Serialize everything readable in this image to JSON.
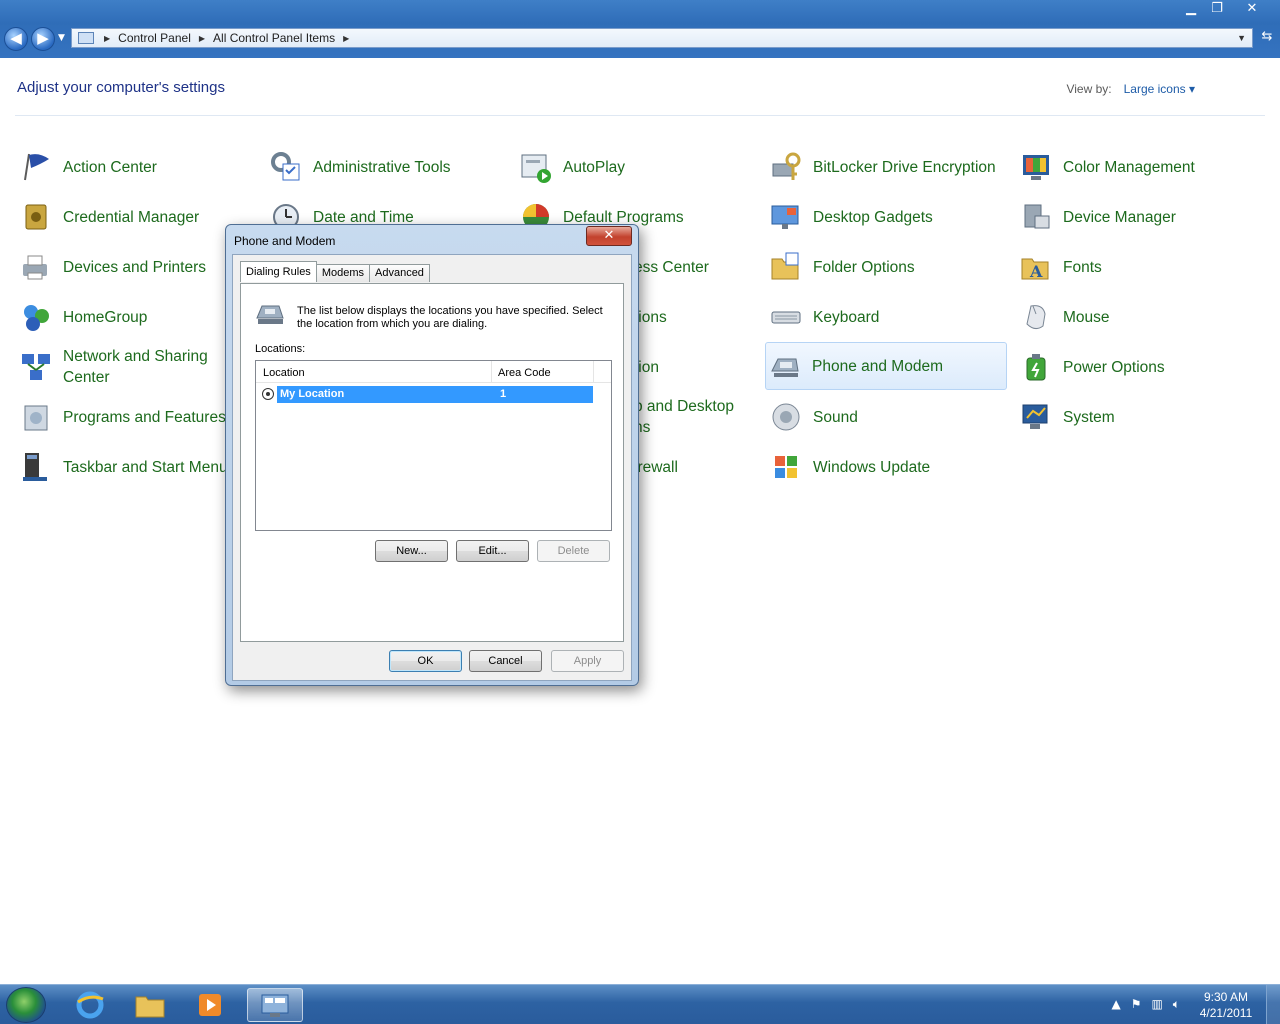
{
  "window": {
    "minimize": "▁",
    "restore": "❐",
    "close": "✕"
  },
  "address_bar": {
    "crumbs": [
      "Control Panel",
      "All Control Panel Items"
    ]
  },
  "heading": "Adjust your computer's settings",
  "view_by": {
    "label": "View by:",
    "value": "Large icons ▾"
  },
  "items": [
    {
      "label": "Action Center",
      "icon": "flag-icon"
    },
    {
      "label": "Administrative Tools",
      "icon": "admin-tools-icon"
    },
    {
      "label": "AutoPlay",
      "icon": "autoplay-icon"
    },
    {
      "label": "BitLocker Drive Encryption",
      "icon": "bitlocker-icon"
    },
    {
      "label": "Color Management",
      "icon": "color-management-icon"
    },
    {
      "label": "Credential Manager",
      "icon": "vault-icon"
    },
    {
      "label": "Date and Time",
      "icon": "clock-icon"
    },
    {
      "label": "Default Programs",
      "icon": "default-programs-icon"
    },
    {
      "label": "Desktop Gadgets",
      "icon": "gadgets-icon"
    },
    {
      "label": "Device Manager",
      "icon": "device-manager-icon"
    },
    {
      "label": "Devices and Printers",
      "icon": "printer-icon"
    },
    {
      "label": "ess Center",
      "icon": ""
    },
    {
      "label": "Folder Options",
      "icon": "folder-icon"
    },
    {
      "label": "Fonts",
      "icon": "fonts-icon"
    },
    {
      "label": "HomeGroup",
      "icon": "homegroup-icon"
    },
    {
      "label": "tions",
      "icon": ""
    },
    {
      "label": "Keyboard",
      "icon": "keyboard-icon"
    },
    {
      "label": "Mouse",
      "icon": "mouse-icon"
    },
    {
      "label": "Network and Sharing Center",
      "icon": "network-icon"
    },
    {
      "label": "tion",
      "icon": ""
    },
    {
      "label": "Phone and Modem",
      "icon": "phone-icon"
    },
    {
      "label": "Power Options",
      "icon": "power-icon"
    },
    {
      "label": "Programs and Features",
      "icon": "programs-icon"
    },
    {
      "label": "p and Desktop ns",
      "icon": ""
    },
    {
      "label": "Sound",
      "icon": "speaker-icon"
    },
    {
      "label": "System",
      "icon": "system-icon"
    },
    {
      "label": "Taskbar and Start Menu",
      "icon": "taskbar-icon"
    },
    {
      "label": "irewall",
      "icon": ""
    },
    {
      "label": "Windows Update",
      "icon": "windows-update-icon"
    }
  ],
  "dialog": {
    "title": "Phone and Modem",
    "close": "✕",
    "tabs": [
      "Dialing Rules",
      "Modems",
      "Advanced"
    ],
    "description": "The list below displays the locations you have specified. Select the location from which you are dialing.",
    "locations_label": "Locations:",
    "columns": [
      "Location",
      "Area Code"
    ],
    "rows": [
      {
        "location": "My Location",
        "area_code": "1"
      }
    ],
    "buttons": {
      "new": "New...",
      "edit": "Edit...",
      "delete": "Delete"
    },
    "footer": {
      "ok": "OK",
      "cancel": "Cancel",
      "apply": "Apply"
    }
  },
  "taskbar": {
    "time": "9:30 AM",
    "date": "4/21/2011"
  },
  "colors": {
    "link_green": "#1d6a1d",
    "heading_blue": "#1e3287",
    "selection": "#3399ff"
  }
}
